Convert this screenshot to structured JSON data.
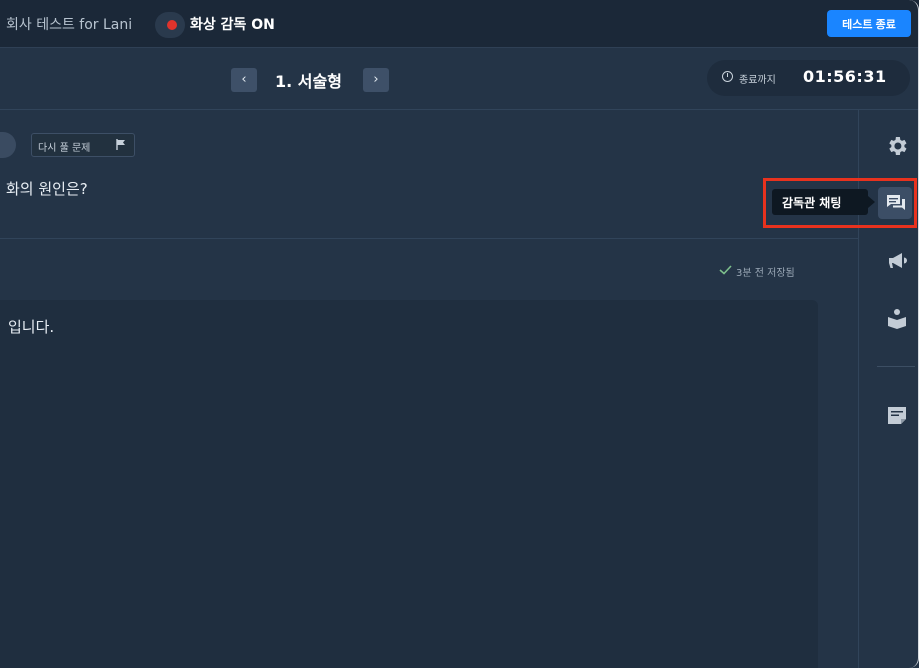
{
  "topbar": {
    "title": "회사 테스트 for Lani",
    "proctor_status": "화상 감독 ON",
    "end_button": "테스트 종료"
  },
  "navbar": {
    "prev_label": "‹",
    "next_label": "›",
    "question_title": "1. 서술형",
    "timer_label": "종료까지",
    "timer_value": "01:56:31"
  },
  "question": {
    "retry_label": "다시 풀 문제",
    "text": "화의 원인은?"
  },
  "answer": {
    "saved_status": "3분 전 저장됨",
    "text": "입니다."
  },
  "sidebar": {
    "tooltip": "감독관 채팅",
    "icons": [
      "gear-icon",
      "chat-icon",
      "megaphone-icon",
      "person-book-icon",
      "memo-icon"
    ]
  },
  "colors": {
    "background": "#243447",
    "topbar": "#1b2838",
    "accent": "#1a85ff",
    "recording": "#e0332c",
    "highlight": "#e8321e"
  }
}
